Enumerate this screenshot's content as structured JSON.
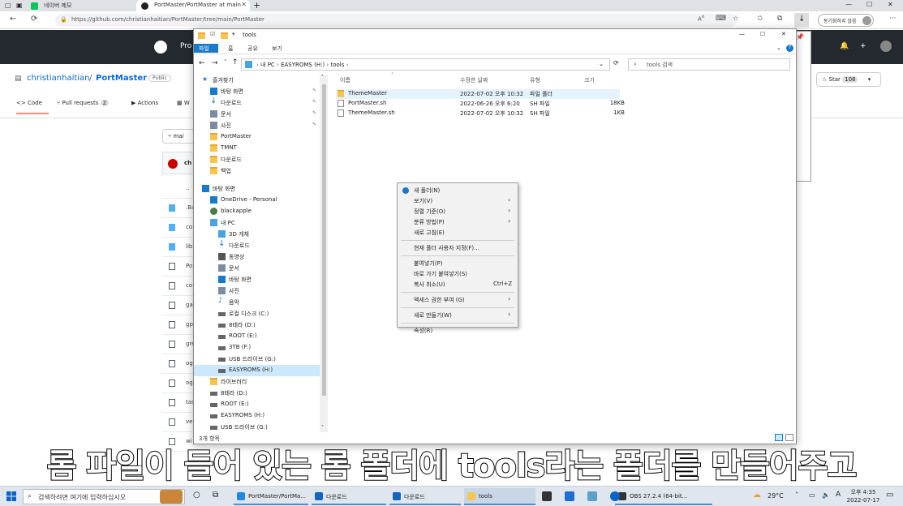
{
  "browser": {
    "tabs": [
      {
        "label": "네이버 메모"
      },
      {
        "label": "PortMaster/PortMaster at main"
      }
    ],
    "new_tab": "+",
    "url": "https://github.com/christianhaitian/PortMaster/tree/main/PortMaster",
    "sync_label": "동기화하지 않음",
    "font_size_label": "A",
    "icons": [
      "back-icon",
      "forward-icon",
      "refresh-icon",
      "lock-icon",
      "read-aloud-icon",
      "star-icon",
      "favorites-icon",
      "collections-icon",
      "download-icon",
      "profile-icon",
      "more-icon"
    ]
  },
  "github": {
    "product": "Pro",
    "owner": "christianhaitian",
    "separator": "/",
    "repo": "PortMaster",
    "visibility": "Public",
    "nav": [
      {
        "label": "Code"
      },
      {
        "label": "Pull requests",
        "count": "2"
      },
      {
        "label": "Actions"
      },
      {
        "label": "W"
      }
    ],
    "branch": "mai",
    "commit_prefix": "ch",
    "star_label": "Star",
    "star_count": "108",
    "files": [
      {
        "name": ".."
      },
      {
        "name": ".Ba"
      },
      {
        "name": "co"
      },
      {
        "name": "lib"
      },
      {
        "name": "Po"
      },
      {
        "name": "co"
      },
      {
        "name": "ga"
      },
      {
        "name": "gp"
      },
      {
        "name": "gre"
      },
      {
        "name": "og"
      },
      {
        "name": "og"
      },
      {
        "name": "tas"
      },
      {
        "name": "ver"
      },
      {
        "name": "wi"
      }
    ]
  },
  "explorer": {
    "title": "tools",
    "ribbon_tabs": [
      "파일",
      "홈",
      "공유",
      "보기"
    ],
    "path": [
      "내 PC",
      "EASYROMS (H:)",
      "tools"
    ],
    "search_placeholder": "tools 검색",
    "nav_items": [
      {
        "label": "즐겨찾기",
        "type": "star",
        "indent": 0,
        "pinned": false
      },
      {
        "label": "바탕 화면",
        "type": "desktop",
        "indent": 1,
        "pinned": true
      },
      {
        "label": "다운로드",
        "type": "download",
        "indent": 1,
        "pinned": true
      },
      {
        "label": "문서",
        "type": "doc",
        "indent": 1,
        "pinned": true
      },
      {
        "label": "사진",
        "type": "pic",
        "indent": 1,
        "pinned": true
      },
      {
        "label": "PortMaster",
        "type": "folder",
        "indent": 1,
        "pinned": false
      },
      {
        "label": "TMNT",
        "type": "folder",
        "indent": 1,
        "pinned": false
      },
      {
        "label": "다운로드",
        "type": "folder",
        "indent": 1,
        "pinned": false
      },
      {
        "label": "백업",
        "type": "folder",
        "indent": 1,
        "pinned": false
      },
      {
        "label": "",
        "type": "gap",
        "indent": 0,
        "pinned": false
      },
      {
        "label": "바탕 화면",
        "type": "desktop",
        "indent": 0,
        "pinned": false
      },
      {
        "label": "OneDrive - Personal",
        "type": "cloud",
        "indent": 1,
        "pinned": false
      },
      {
        "label": "blackapple",
        "type": "user",
        "indent": 1,
        "pinned": false
      },
      {
        "label": "내 PC",
        "type": "pc",
        "indent": 1,
        "pinned": false
      },
      {
        "label": "3D 개체",
        "type": "cube",
        "indent": 2,
        "pinned": false
      },
      {
        "label": "다운로드",
        "type": "download",
        "indent": 2,
        "pinned": false
      },
      {
        "label": "동영상",
        "type": "video",
        "indent": 2,
        "pinned": false
      },
      {
        "label": "문서",
        "type": "doc",
        "indent": 2,
        "pinned": false
      },
      {
        "label": "바탕 화면",
        "type": "desktop",
        "indent": 2,
        "pinned": false
      },
      {
        "label": "사진",
        "type": "pic",
        "indent": 2,
        "pinned": false
      },
      {
        "label": "음악",
        "type": "music",
        "indent": 2,
        "pinned": false
      },
      {
        "label": "로컬 디스크 (C:)",
        "type": "drive",
        "indent": 2,
        "pinned": false
      },
      {
        "label": "8테라 (D:)",
        "type": "drive",
        "indent": 2,
        "pinned": false
      },
      {
        "label": "ROOT (E:)",
        "type": "drive",
        "indent": 2,
        "pinned": false
      },
      {
        "label": "3TB (F:)",
        "type": "drive",
        "indent": 2,
        "pinned": false
      },
      {
        "label": "USB 드라이브 (G:)",
        "type": "drive",
        "indent": 2,
        "pinned": false
      },
      {
        "label": "EASYROMS (H:)",
        "type": "drive",
        "indent": 2,
        "pinned": false,
        "selected": true
      },
      {
        "label": "라이브러리",
        "type": "folder",
        "indent": 1,
        "pinned": false
      },
      {
        "label": "8테라 (D:)",
        "type": "drive",
        "indent": 1,
        "pinned": false
      },
      {
        "label": "ROOT (E:)",
        "type": "drive",
        "indent": 1,
        "pinned": false
      },
      {
        "label": "EASYROMS (H:)",
        "type": "drive",
        "indent": 1,
        "pinned": false
      },
      {
        "label": "USB 드라이브 (G:)",
        "type": "drive",
        "indent": 1,
        "pinned": false
      }
    ],
    "columns": {
      "name": "이름",
      "date": "수정한 날짜",
      "type": "유형",
      "size": "크기"
    },
    "files": [
      {
        "name": "ThemeMaster",
        "date": "2022-07-02 오후 10:32",
        "type": "파일 폴더",
        "size": "",
        "kind": "folder",
        "selected": true
      },
      {
        "name": "PortMaster.sh",
        "date": "2022-06-26 오후 6:20",
        "type": "SH 파일",
        "size": "18KB",
        "kind": "file"
      },
      {
        "name": "ThemeMaster.sh",
        "date": "2022-07-02 오후 10:32",
        "type": "SH 파일",
        "size": "1KB",
        "kind": "file"
      }
    ],
    "status": "3개 항목",
    "window_buttons": [
      "—",
      "☐",
      "✕"
    ]
  },
  "context_menu": {
    "items": [
      {
        "label": "새 폴더(N)",
        "shortcut": "",
        "submenu": false,
        "icon": true
      },
      {
        "label": "보기(V)",
        "shortcut": "",
        "submenu": true
      },
      {
        "label": "정렬 기준(O)",
        "shortcut": "",
        "submenu": true
      },
      {
        "label": "분류 방법(P)",
        "shortcut": "",
        "submenu": true
      },
      {
        "label": "새로 고침(E)",
        "shortcut": "",
        "submenu": false
      },
      {
        "sep": true
      },
      {
        "label": "현재 폴더 사용자 지정(F)...",
        "shortcut": "",
        "submenu": false
      },
      {
        "sep": true
      },
      {
        "label": "붙여넣기(P)",
        "shortcut": "",
        "submenu": false
      },
      {
        "label": "바로 가기 붙여넣기(S)",
        "shortcut": "",
        "submenu": false
      },
      {
        "label": "복사 취소(U)",
        "shortcut": "Ctrl+Z",
        "submenu": false
      },
      {
        "sep": true
      },
      {
        "label": "액세스 권한 부여 (G)",
        "shortcut": "",
        "submenu": true
      },
      {
        "sep": true
      },
      {
        "label": "새로 만들기(W)",
        "shortcut": "",
        "submenu": true
      },
      {
        "sep": true
      },
      {
        "label": "속성(R)",
        "shortcut": "",
        "submenu": false
      }
    ]
  },
  "subtitle": "롬 파일이 들어 있는 롬 폴더에 tools라는 폴더를 만들어주고",
  "taskbar": {
    "search_placeholder": "검색하려면 여기에 입력하십시오",
    "apps": [
      {
        "label": "PortMaster/PortMa...",
        "color": "#1e88e5"
      },
      {
        "label": "다운로드",
        "color": "#1565c0"
      },
      {
        "label": "다운로드",
        "color": "#1565c0"
      },
      {
        "label": "tools",
        "color": "#f6c550"
      },
      {
        "label": "OBS 27.2.4 (64-bit...",
        "color": "#333333"
      }
    ],
    "weather": "29°C",
    "time": "오후 4:35",
    "date": "2022-07-17",
    "ime": "A"
  }
}
